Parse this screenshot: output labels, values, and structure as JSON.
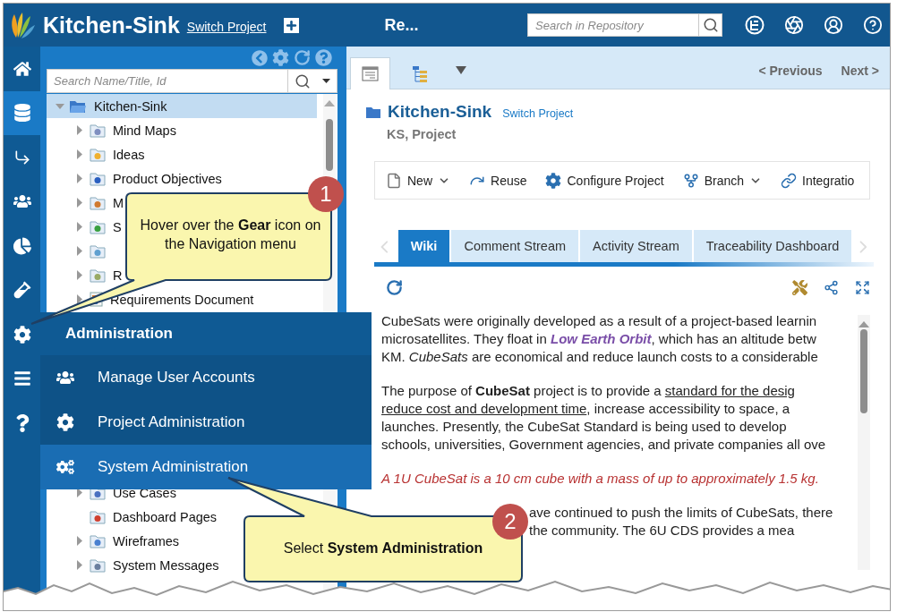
{
  "header": {
    "app_title": "Kitchen-Sink",
    "switch_link": "Switch Project",
    "page_title": "Re...",
    "search": {
      "placeholder": "Search in Repository"
    }
  },
  "nav_rail": [
    {
      "kind": "home",
      "selected": false
    },
    {
      "kind": "database",
      "selected": true
    },
    {
      "kind": "arrow",
      "selected": false
    },
    {
      "kind": "users",
      "selected": false
    },
    {
      "kind": "chart",
      "selected": false
    },
    {
      "kind": "vial",
      "selected": false
    },
    {
      "kind": "gear",
      "selected": false
    },
    {
      "kind": "menu",
      "selected": false
    },
    {
      "kind": "help",
      "selected": false
    }
  ],
  "tree_panel": {
    "search": {
      "placeholder": "Search Name/Title, Id"
    },
    "items": [
      {
        "label": "Kitchen-Sink",
        "expanded": true,
        "selected": true,
        "children": [
          {
            "label": "Mind Maps",
            "kind": "folder",
            "expandable": true
          },
          {
            "label": "Ideas",
            "kind": "folder",
            "expandable": true
          },
          {
            "label": "Product Objectives",
            "kind": "folder",
            "expandable": true
          },
          {
            "label": "M",
            "kind": "folder",
            "expandable": true
          },
          {
            "label": "S",
            "kind": "folder",
            "expandable": true
          },
          {
            "kind": "folder",
            "expandable": true
          },
          {
            "label": "R",
            "kind": "folder",
            "expandable": true
          },
          {
            "label": "Requirements Document",
            "kind": "document",
            "expandable": true
          },
          {
            "label": "Use Cases",
            "kind": "folder",
            "expandable": true
          },
          {
            "label": "Dashboard Pages",
            "kind": "folder",
            "expandable": false
          },
          {
            "label": "Wireframes",
            "kind": "folder",
            "expandable": true
          },
          {
            "label": "System Messages",
            "kind": "folder",
            "expandable": true
          }
        ]
      }
    ]
  },
  "admin_menu": {
    "title": "Administration",
    "items": [
      {
        "label": "Manage User Accounts",
        "kind": "users",
        "selected": false
      },
      {
        "label": "Project Administration",
        "kind": "project",
        "selected": false
      },
      {
        "label": "System Administration",
        "kind": "system",
        "selected": true
      }
    ]
  },
  "view_tabs": [
    {
      "kind": "document",
      "selected": true
    },
    {
      "kind": "tree",
      "selected": false
    }
  ],
  "pager": {
    "previous": "< Previous",
    "next": "Next >"
  },
  "project": {
    "title": "Kitchen-Sink",
    "switch_link": "Switch Project",
    "subtitle": "KS, Project"
  },
  "toolbar": [
    {
      "label": "New",
      "kind": "file",
      "dropdown": true
    },
    {
      "label": "Reuse",
      "kind": "reuse",
      "dropdown": false
    },
    {
      "label": "Configure Project",
      "kind": "gear",
      "dropdown": false
    },
    {
      "label": "Branch",
      "kind": "branch",
      "dropdown": true
    },
    {
      "label": "Integratio",
      "kind": "link",
      "dropdown": false
    }
  ],
  "tabs": [
    {
      "label": "Wiki",
      "selected": true
    },
    {
      "label": "Comment Stream",
      "selected": false
    },
    {
      "label": "Activity Stream",
      "selected": false
    },
    {
      "label": "Traceability Dashboard",
      "selected": false
    }
  ],
  "wiki": [
    {
      "kind": "text",
      "lines": [
        [
          {
            "text": "CubeSats were originally developed as a result of a project-based learnin"
          }
        ],
        [
          {
            "text": "microsatellites. They float in "
          },
          {
            "text": "Low Earth Orbit",
            "kind": "emphasis"
          },
          {
            "text": ", which has an altitude betw"
          }
        ],
        [
          {
            "text": "KM. *CubeSats* are economical and reduce launch costs to a considerable"
          }
        ]
      ]
    },
    {
      "kind": "text",
      "lines": [
        [
          {
            "text": "The purpose of **CubeSat** project is to provide a "
          },
          {
            "text": "standard for the desig",
            "kind": "underline"
          }
        ],
        [
          {
            "text": "reduce cost and development time",
            "kind": "underline"
          },
          {
            "text": ", increase accessibility to space, a"
          }
        ],
        [
          {
            "text": "launches. Presently, the CubeSat Standard is being used to develop"
          }
        ],
        [
          {
            "text": "schools, universities, Government agencies, and private companies all ove"
          }
        ]
      ]
    },
    {
      "kind": "note",
      "lines": [
        [
          {
            "text": "A 1U CubeSat is a 10 cm cube with a mass of up to approximately 1.5 kg."
          }
        ]
      ]
    },
    {
      "kind": "covered",
      "lines": [
        [
          {
            "text": "ave continued to push the limits of CubeSats, there"
          }
        ],
        [
          {
            "text": "the community. The 6U CDS provides a mea"
          }
        ]
      ]
    }
  ],
  "callouts": [
    {
      "number": "1",
      "text": "Hover over the **Gear** icon on the Navigation menu"
    },
    {
      "number": "2",
      "text": "Select **System Administration**"
    }
  ]
}
